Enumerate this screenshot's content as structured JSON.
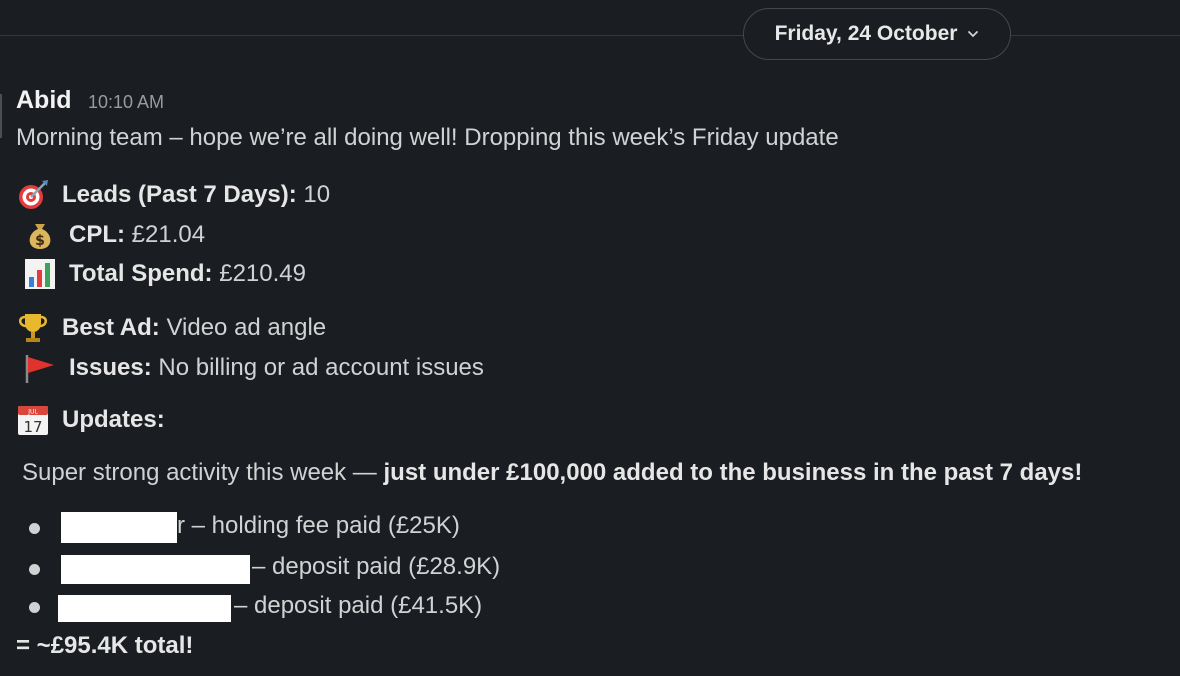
{
  "header": {
    "date": "Friday, 24 October"
  },
  "message": {
    "author": "Abid",
    "time": "10:10 AM",
    "intro": "Morning team – hope we’re all doing well! Dropping this week’s Friday update",
    "stats": [
      {
        "icon": "target-dart-icon",
        "label": "Leads (Past 7 Days):",
        "value": " 10"
      },
      {
        "icon": "money-bag-icon",
        "label": "CPL:",
        "value": " £21.04"
      },
      {
        "icon": "bar-chart-icon",
        "label": "Total Spend:",
        "value": " £210.49"
      },
      {
        "icon": "trophy-icon",
        "label": "Best Ad:",
        "value": " Video ad angle"
      },
      {
        "icon": "red-flag-icon",
        "label": "Issues:",
        "value": " No billing or ad account issues"
      },
      {
        "icon": "calendar-icon",
        "label": "Updates:",
        "value": ""
      }
    ],
    "summary_prefix": "Super strong activity this week — ",
    "summary_bold": "just under £100,000 added to the business in the past 7 days!",
    "items": [
      {
        "trail": "r",
        "text": " – holding fee paid (£25K)"
      },
      {
        "text": "– deposit paid (£28.9K)"
      },
      {
        "text": "– deposit paid (£41.5K)"
      }
    ],
    "total": "= ~£95.4K total!"
  },
  "colors": {
    "background": "#1a1d21",
    "text": "#d1d2d3",
    "muted": "#9a9b9d",
    "redaction": "#ffffff"
  }
}
